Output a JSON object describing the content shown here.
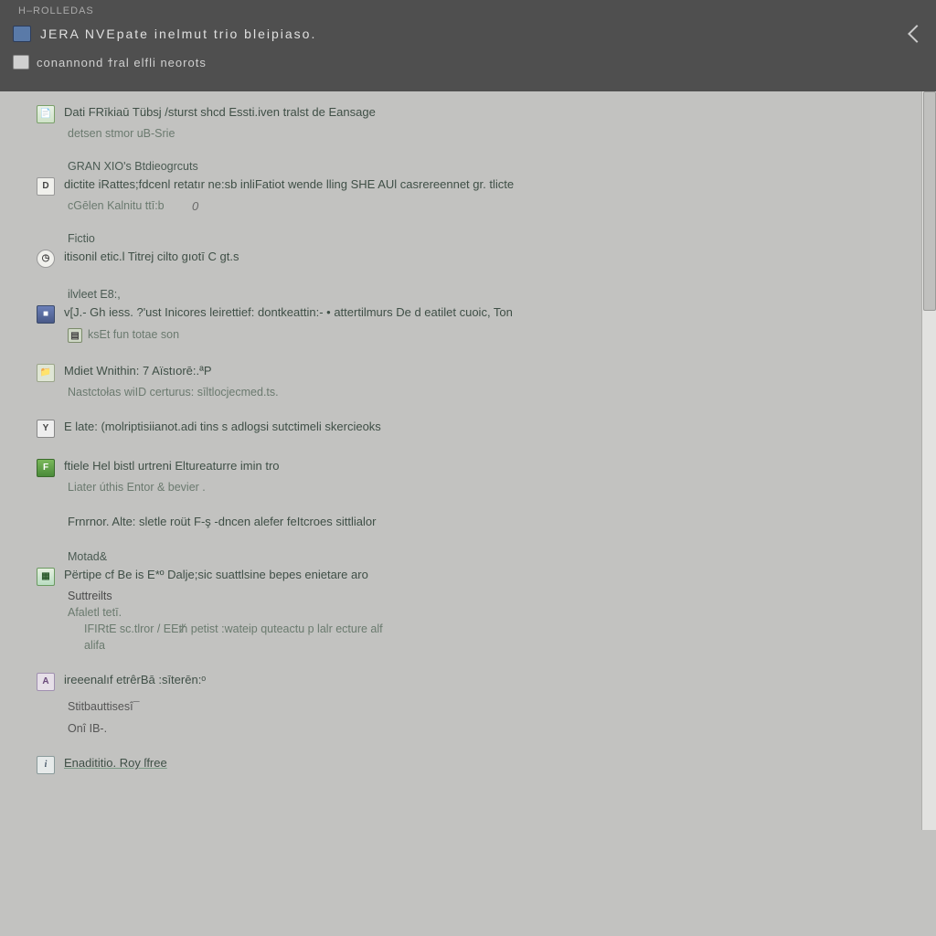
{
  "header": {
    "crumb": "H–ROLLEDAS",
    "title_raw": "JERA NVEpate inelmut trio bleipiaso.",
    "subtitle": "conannond ϯral elfli neorots"
  },
  "annot_top": "0",
  "content": [
    {
      "icon": "doc",
      "icon_name": "document-icon",
      "title": "Dati FRīkiaū Tübsj /sturst shcd Essti.iven tralst de Eansage",
      "subline": "detsen stmor uB-Srie"
    },
    {
      "icon": "d",
      "icon_name": "letter-d-icon",
      "head": "GRAN XIO's Btdieogrcuts",
      "title": "dictite iRattes;fdcenl retatır ne:sb inliFatiot wende lling SHE AUl casrereennet gr. tlicte",
      "subline": "cGēlen Kalnitu ttī:b"
    },
    {
      "icon": "clock",
      "icon_name": "clock-icon",
      "head": "Fictio",
      "title": "itisonil etic.l Titrej cilto gıotī C gt.s"
    },
    {
      "icon": "blue",
      "icon_name": "square-icon",
      "head": "ilvleet E8:,",
      "title": "v[J.- Gh iess. ?'ust Inicores leirettief: dontkeattin:- • attertilmurs De d eatilet cuoic, Ton",
      "subline": "ksEt fun totae son",
      "subicon": "grid"
    },
    {
      "icon": "folder",
      "icon_name": "folder-icon",
      "title": "Mdiet Wnithin: 7 Aïstıorē:.ªP",
      "subline": "Nastctołas  wiID certurus: sīltlocjecmed.ts."
    },
    {
      "icon": "y",
      "icon_name": "letter-y-icon",
      "title": "E late: (molriptisiianot.adi tins s adlogsi sutctimeli skercieoks"
    },
    {
      "icon": "f",
      "icon_name": "letter-f-icon",
      "title": "ftiele Hel bistl urtreni Eltureaturre imin tro",
      "subline": "Liater úthis Entor & bevier ."
    },
    {
      "plain": true,
      "title": "Frnrnor. Alte: sletle roüt  F-ş -dncen alefer feItcroes sittlialor"
    },
    {
      "icon": "sheet",
      "icon_name": "sheet-icon",
      "head": "Motad&",
      "title": "Përtipe cf Be is E*º Dalje;sic suattlsine bepes enietare aro",
      "subtree": [
        "Suttreilts",
        "Afaletl tetī.",
        "IFIRtE sc.tlror / EEᵺ   petist :wateip quteactu p lalr ecture alf",
        "alifa"
      ]
    },
    {
      "icon": "a",
      "icon_name": "letter-a-icon",
      "title": "ireeenalıf etrêrBā :sīterēn:ᵒ",
      "extras": [
        "Stitbauttisesî¯",
        "Onî IB-."
      ]
    },
    {
      "icon": "i",
      "icon_name": "info-icon",
      "title": "Enadititio. Roy  ſfree",
      "underline": true
    }
  ]
}
